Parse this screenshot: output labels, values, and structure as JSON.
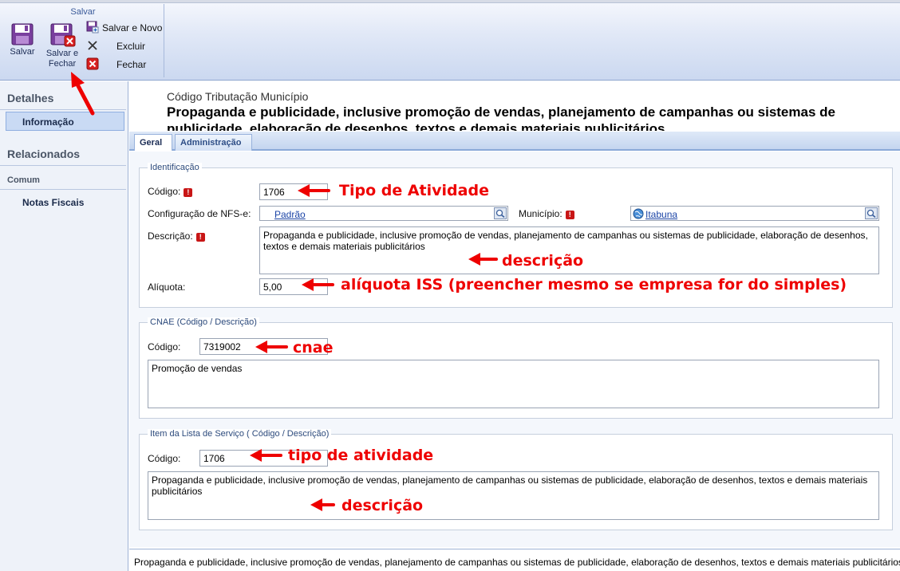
{
  "ribbon": {
    "group_title": "Salvar",
    "salvar": "Salvar",
    "salvar_fechar_line1": "Salvar e",
    "salvar_fechar_line2": "Fechar",
    "salvar_novo": "Salvar e Novo",
    "excluir": "Excluir",
    "fechar": "Fechar"
  },
  "sidebar": {
    "detalhes": "Detalhes",
    "informacao": "Informação",
    "relacionados": "Relacionados",
    "comum": "Comum",
    "notas_fiscais": "Notas Fiscais"
  },
  "header": {
    "subtitle": "Código Tributação Município",
    "title": "Propaganda e publicidade, inclusive promoção de vendas, planejamento de campanhas ou sistemas de publicidade, elaboração de desenhos, textos e demais materiais publicitários"
  },
  "tabs": {
    "geral": "Geral",
    "administracao": "Administração"
  },
  "identificacao": {
    "legend": "Identificação",
    "codigo_label": "Código:",
    "codigo_value": "1706",
    "config_label": "Configuração de NFS-e:",
    "config_value": "Padrão",
    "municipio_label": "Município:",
    "municipio_value": "Itabuna",
    "descricao_label": "Descrição:",
    "descricao_value": "Propaganda e publicidade, inclusive promoção de vendas, planejamento de campanhas ou sistemas de publicidade, elaboração de desenhos, textos e demais materiais publicitários",
    "aliquota_label": "Alíquota:",
    "aliquota_value": "5,00"
  },
  "cnae": {
    "legend": "CNAE (Código / Descrição)",
    "codigo_label": "Código:",
    "codigo_value": "7319002",
    "descricao_value": "Promoção de vendas"
  },
  "item_lista": {
    "legend": "Item da Lista de Serviço ( Código / Descrição)",
    "codigo_label": "Código:",
    "codigo_value": "1706",
    "descricao_value": "Propaganda e publicidade, inclusive promoção de vendas, planejamento de campanhas ou sistemas de publicidade, elaboração de desenhos, textos e demais materiais publicitários"
  },
  "annotations": {
    "tipo_atividade": "Tipo de Atividade",
    "descricao1": "descrição",
    "aliquota": "alíquota ISS (preencher mesmo se empresa for do simples)",
    "cnae": "cnae",
    "tipo_atividade2": "tipo de atividade",
    "descricao2": "descrição"
  },
  "footer": "Propaganda e publicidade, inclusive promoção de vendas, planejamento de campanhas ou sistemas de publicidade, elaboração de desenhos, textos e demais materiais publicitários",
  "colors": {
    "annotation": "#e00000",
    "link": "#1b44a6",
    "required": "#c81616"
  }
}
